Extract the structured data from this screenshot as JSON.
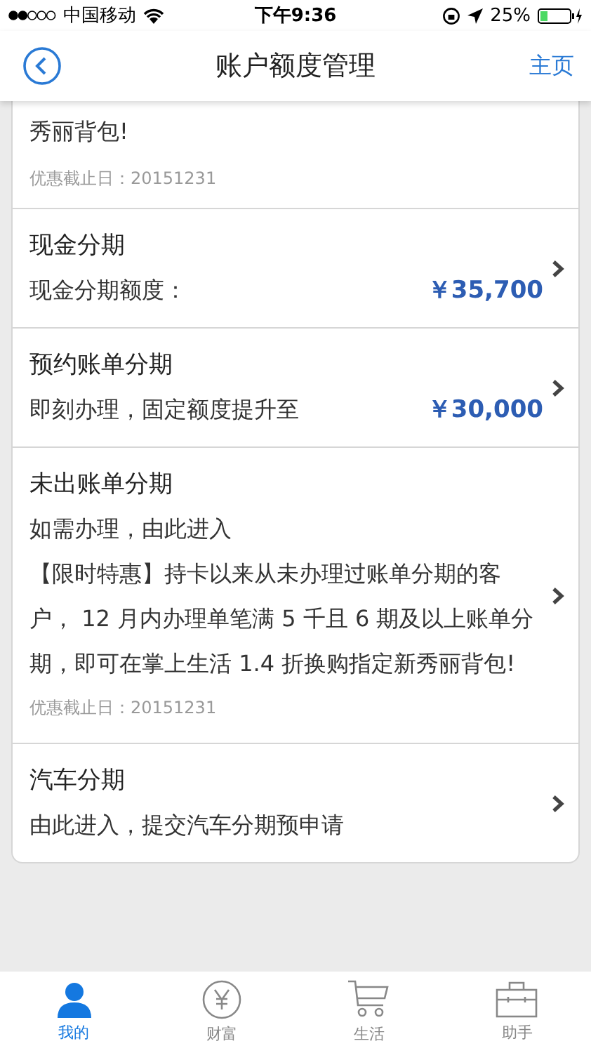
{
  "status_bar": {
    "carrier": "中国移动",
    "time": "下午9:36",
    "battery": "25%"
  },
  "nav": {
    "title": "账户额度管理",
    "home": "主页"
  },
  "sections": [
    {
      "kind": "tail",
      "promo": "秀丽背包!",
      "deadline": "优惠截止日：20151231"
    },
    {
      "kind": "amount",
      "title": "现金分期",
      "subtitle": "现金分期额度：",
      "amount": "￥35,700"
    },
    {
      "kind": "amount",
      "title": "预约账单分期",
      "subtitle": "即刻办理，固定额度提升至",
      "amount": "￥30,000"
    },
    {
      "kind": "promo",
      "title": "未出账单分期",
      "subtitle": "如需办理，由此进入",
      "promo": "【限时特惠】持卡以来从未办理过账单分期的客户， 12 月内办理单笔满 5 千且 6 期及以上账单分期，即可在掌上生活 1.4 折换购指定新秀丽背包!",
      "deadline": "优惠截止日：20151231"
    },
    {
      "kind": "plain",
      "title": "汽车分期",
      "subtitle": "由此进入，提交汽车分期预申请"
    }
  ],
  "tabs": [
    {
      "kind": "person",
      "label": "我的",
      "selected": true
    },
    {
      "kind": "yuan",
      "label": "财富",
      "selected": false
    },
    {
      "kind": "cart",
      "label": "生活",
      "selected": false
    },
    {
      "kind": "briefcase",
      "label": "助手",
      "selected": false
    }
  ]
}
